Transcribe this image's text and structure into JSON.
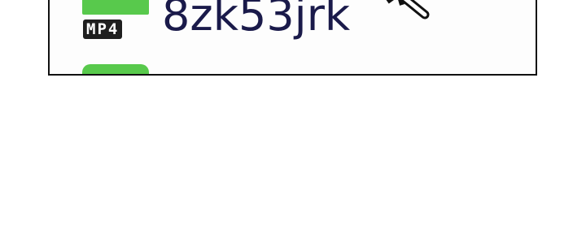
{
  "file_list": {
    "items": [
      {
        "name": "8zk53jrk",
        "type_label": "MP4",
        "icon": "mp4-video-file-icon",
        "icon_color": "#58c94c"
      },
      {
        "name": "",
        "type_label": "",
        "icon": "mp4-video-file-icon",
        "icon_color": "#58c94c"
      }
    ]
  },
  "cursor": {
    "icon": "mouse-pointer-icon"
  }
}
